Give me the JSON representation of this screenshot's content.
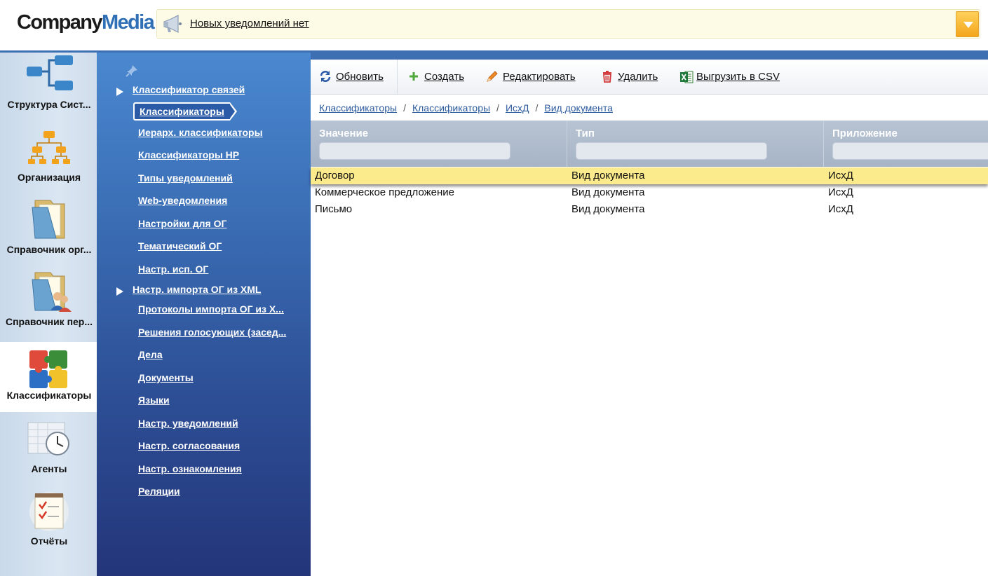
{
  "header": {
    "logo_part1": "Company",
    "logo_part2": "Media",
    "notification_text": "Новых уведомлений нет"
  },
  "leftbar": {
    "items": [
      {
        "label": "Структура Сист..."
      },
      {
        "label": "Организация"
      },
      {
        "label": "Справочник орг..."
      },
      {
        "label": "Справочник пер..."
      },
      {
        "label": "Классификаторы"
      },
      {
        "label": "Агенты"
      },
      {
        "label": "Отчёты"
      }
    ]
  },
  "menu": {
    "group1": "Классификатор связей",
    "group1_items": [
      "Классификаторы",
      "Иерарх. классификаторы",
      "Классификаторы НР",
      "Типы уведомлений",
      "Web-уведомления",
      "Настройки для ОГ",
      "Тематический ОГ",
      "Настр. исп. ОГ"
    ],
    "group2": "Настр. импорта ОГ из XML",
    "group2_items": [
      "Протоколы импорта ОГ из Х...",
      "Решения голосующих (засед...",
      "Дела",
      "Документы",
      "Языки",
      "Настр. уведомлений",
      "Настр. согласования",
      "Настр. ознакомления",
      "Реляции"
    ]
  },
  "toolbar": {
    "refresh": "Обновить",
    "create": "Создать",
    "edit": "Редактировать",
    "delete": "Удалить",
    "export": "Выгрузить в CSV"
  },
  "breadcrumb": [
    "Классификаторы",
    "Классификаторы",
    "ИсхД",
    "Вид документа"
  ],
  "grid": {
    "columns": [
      "Значение",
      "Тип",
      "Приложение"
    ],
    "rows": [
      [
        "Договор",
        "Вид документа",
        "ИсхД"
      ],
      [
        "Коммерческое предложение",
        "Вид документа",
        "ИсхД"
      ],
      [
        "Письмо",
        "Вид документа",
        "ИсхД"
      ]
    ]
  },
  "colors": {
    "accent_blue": "#3e6fb2",
    "selected_row": "#fbeb8c"
  }
}
